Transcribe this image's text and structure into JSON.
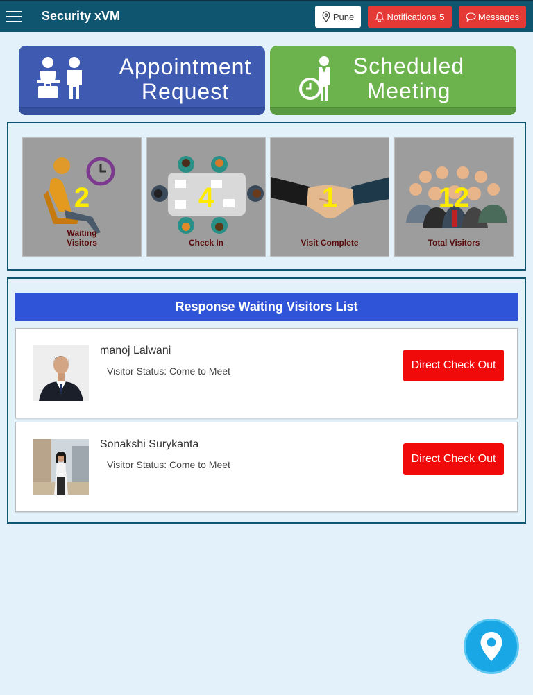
{
  "header": {
    "title": "Security xVM",
    "location": "Pune",
    "notifications_label": "Notifications",
    "notifications_count": "5",
    "messages_label": "Messages"
  },
  "tiles": {
    "appointment": {
      "line1": "Appointment",
      "line2": "Request"
    },
    "scheduled": {
      "line1": "Scheduled",
      "line2": "Meeting"
    }
  },
  "stats": [
    {
      "value": "2",
      "label_line1": "Waiting",
      "label_line2": "Visitors"
    },
    {
      "value": "4",
      "label_line1": "Check In",
      "label_line2": ""
    },
    {
      "value": "1",
      "label_line1": "Visit Complete",
      "label_line2": ""
    },
    {
      "value": "12",
      "label_line1": "Total Visitors",
      "label_line2": ""
    }
  ],
  "list": {
    "title": "Response Waiting Visitors List",
    "visitors": [
      {
        "name": "manoj Lalwani",
        "status": "Visitor Status: Come to Meet",
        "action": "Direct Check Out"
      },
      {
        "name": "Sonakshi Surykanta",
        "status": "Visitor Status: Come to Meet",
        "action": "Direct Check Out"
      }
    ]
  },
  "colors": {
    "header_bg": "#0f5570",
    "accent_red": "#e53935",
    "appointment_tile": "#3f5bb1",
    "scheduled_tile": "#6cb34e",
    "list_header": "#2f54d8",
    "stat_number": "#ffeb00"
  },
  "icons": [
    "menu-icon",
    "location-pin-icon",
    "bell-icon",
    "chat-bubble-icon",
    "map-pin-icon"
  ]
}
